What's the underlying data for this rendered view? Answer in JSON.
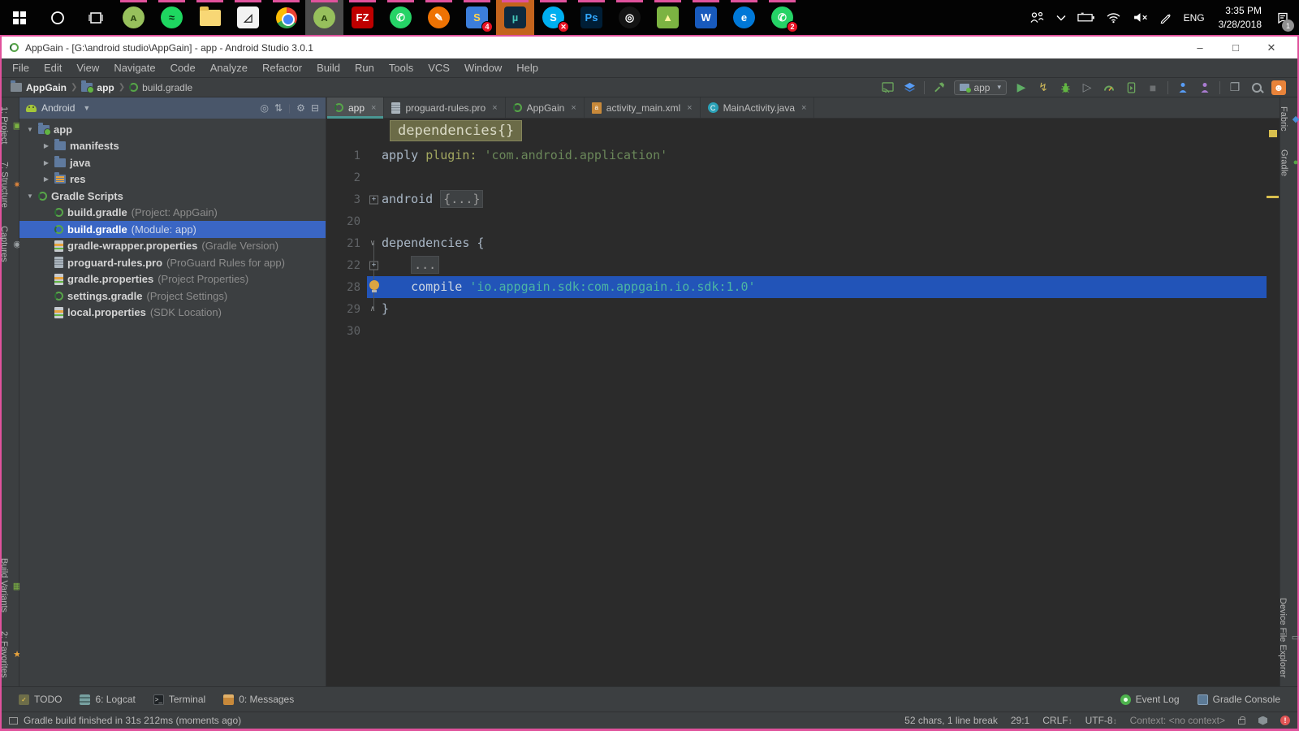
{
  "colors": {
    "accent_pink": "#e0529c",
    "panel_bg": "#3c3f41",
    "panel_header_bg": "#49566a",
    "editor_bg": "#2b2b2b",
    "tree_selection": "#3a66c4",
    "editor_selection": "#2254b8",
    "tab_underline": "#4a9793",
    "string_green": "#6a8759",
    "string_teal": "#4cb5a3",
    "lens_bg": "#6b6b47",
    "line_number": "#606366",
    "bulb_yellow": "#dca541",
    "warning_stripe": "#d9bf4e",
    "error_red": "#e05555",
    "event_green": "#4db24d"
  },
  "taskbar": {
    "apps": [
      {
        "name": "start-button",
        "kind": "win",
        "open": false
      },
      {
        "name": "cortana-button",
        "kind": "ring",
        "open": false
      },
      {
        "name": "task-view-button",
        "kind": "taskview",
        "open": false
      },
      {
        "name": "android-studio-icon",
        "kind": "tile",
        "shape": "circle",
        "bg": "#97c05c",
        "fg": "#2d4a12",
        "glyph": "ᴀ",
        "open": true
      },
      {
        "name": "spotify-icon",
        "kind": "tile",
        "shape": "circle",
        "bg": "#1ed760",
        "fg": "#0a2a12",
        "glyph": "≈",
        "open": true
      },
      {
        "name": "file-explorer-icon",
        "kind": "folder",
        "open": true
      },
      {
        "name": "notepad-icon",
        "kind": "tile",
        "shape": "square",
        "bg": "#f2f2f2",
        "fg": "#222222",
        "glyph": "◿",
        "open": true
      },
      {
        "name": "chrome-icon",
        "kind": "chrome",
        "open": true
      },
      {
        "name": "android-studio-active-icon",
        "kind": "tile",
        "shape": "circle",
        "bg": "#97c05c",
        "fg": "#2d4a12",
        "glyph": "ᴀ",
        "open": true,
        "active": true
      },
      {
        "name": "filezilla-icon",
        "kind": "tile",
        "shape": "square",
        "bg": "#bf0000",
        "fg": "#ffffff",
        "glyph": "FZ",
        "open": true
      },
      {
        "name": "whatsapp-icon",
        "kind": "tile",
        "shape": "circle",
        "bg": "#25d366",
        "fg": "#ffffff",
        "glyph": "✆",
        "open": true
      },
      {
        "name": "pen-tool-app-icon",
        "kind": "tile",
        "shape": "circle",
        "bg": "#ee7203",
        "fg": "#ffffff",
        "glyph": "✎",
        "open": true
      },
      {
        "name": "mail-app-badge-icon",
        "kind": "tile",
        "shape": "square",
        "bg": "#3c7edb",
        "fg": "#ffd34d",
        "glyph": "S",
        "badge": "4",
        "open": true
      },
      {
        "name": "utorrent-flashing-icon",
        "kind": "tile",
        "shape": "square",
        "bg": "#0e2a3f",
        "fg": "#45c8bc",
        "glyph": "µ",
        "open": true,
        "flash": true
      },
      {
        "name": "skype-error-icon",
        "kind": "tile",
        "shape": "circle",
        "bg": "#00aff0",
        "fg": "#ffffff",
        "glyph": "S",
        "badge": "✕",
        "open": true
      },
      {
        "name": "photoshop-icon",
        "kind": "tile",
        "shape": "square",
        "bg": "#001e36",
        "fg": "#31a8ff",
        "glyph": "Ps",
        "open": true
      },
      {
        "name": "recorder-app-icon",
        "kind": "tile",
        "shape": "circle",
        "bg": "#141414",
        "fg": "#ffffff",
        "glyph": "◎",
        "open": true
      },
      {
        "name": "photos-app-icon",
        "kind": "tile",
        "shape": "square",
        "bg": "#7cb342",
        "fg": "#fff59d",
        "glyph": "▲",
        "open": true
      },
      {
        "name": "word-icon",
        "kind": "tile",
        "shape": "square",
        "bg": "#185abd",
        "fg": "#ffffff",
        "glyph": "W",
        "open": true
      },
      {
        "name": "edge-icon",
        "kind": "tile",
        "shape": "circle",
        "bg": "#0078d7",
        "fg": "#ffffff",
        "glyph": "e",
        "open": true
      },
      {
        "name": "whatsapp-badge-icon",
        "kind": "tile",
        "shape": "circle",
        "bg": "#25d366",
        "fg": "#ffffff",
        "glyph": "✆",
        "badge": "2",
        "open": true
      }
    ],
    "tray": [
      {
        "name": "people-icon",
        "svg": "people"
      },
      {
        "name": "chevron-icon",
        "svg": "chevron"
      },
      {
        "name": "battery-icon",
        "svg": "battery"
      },
      {
        "name": "wifi-icon",
        "svg": "wifi"
      },
      {
        "name": "volume-muted-icon",
        "svg": "mute"
      },
      {
        "name": "pen-icon",
        "svg": "pen"
      }
    ],
    "language": "ENG",
    "time": "3:35 PM",
    "date": "3/28/2018",
    "notification_badge": "1"
  },
  "window": {
    "title": "AppGain - [G:\\android studio\\AppGain] - app - Android Studio 3.0.1"
  },
  "menu": [
    "File",
    "Edit",
    "View",
    "Navigate",
    "Code",
    "Analyze",
    "Refactor",
    "Build",
    "Run",
    "Tools",
    "VCS",
    "Window",
    "Help"
  ],
  "breadcrumb": [
    {
      "label": "AppGain",
      "icon": "folder-dark",
      "bold": true
    },
    {
      "label": "app",
      "icon": "folder-app",
      "bold": true
    },
    {
      "label": "build.gradle",
      "icon": "gradle",
      "bold": false
    }
  ],
  "run_toolbar": {
    "config_label": "app"
  },
  "left_stripe": {
    "top": [
      {
        "label": "1: Project",
        "icon": "▣",
        "icolor": "#7cb342"
      },
      {
        "label": "7: Structure",
        "icon": "✷",
        "icolor": "#d9833c"
      },
      {
        "label": "Captures",
        "icon": "◉",
        "icolor": "#9aa0a3"
      }
    ],
    "bottom": [
      {
        "label": "Build Variants",
        "icon": "▦",
        "icolor": "#7cb342"
      },
      {
        "label": "2: Favorites",
        "icon": "★",
        "icolor": "#e8a33d"
      }
    ]
  },
  "right_stripe": {
    "top": [
      {
        "label": "Fabric",
        "icon": "◆",
        "icolor": "#4a90d9"
      },
      {
        "label": "Gradle",
        "icon": "●",
        "icolor": "#57a549"
      }
    ],
    "bottom": [
      {
        "label": "Device File Explorer",
        "icon": "▭",
        "icolor": "#9aa0a3"
      }
    ]
  },
  "project_panel": {
    "view_label": "Android",
    "header_tools": [
      {
        "name": "locate-file-icon",
        "glyph": "◎"
      },
      {
        "name": "collapse-all-icon",
        "glyph": "⇅"
      },
      {
        "name": "toolbar-divider",
        "glyph": "|"
      },
      {
        "name": "settings-gear-icon",
        "glyph": "⚙"
      },
      {
        "name": "hide-panel-icon",
        "glyph": "⊟"
      }
    ],
    "tree": [
      {
        "label": "app",
        "icon": "folder-app",
        "indent": 0,
        "chev": "▼",
        "bold": true
      },
      {
        "label": "manifests",
        "icon": "folder",
        "indent": 1,
        "chev": "▶"
      },
      {
        "label": "java",
        "icon": "folder",
        "indent": 1,
        "chev": "▶"
      },
      {
        "label": "res",
        "icon": "folder-res",
        "indent": 1,
        "chev": "▶"
      },
      {
        "label": "Gradle Scripts",
        "icon": "gradle",
        "indent": 0,
        "chev": "▼"
      },
      {
        "label": "build.gradle",
        "detail": "(Project: AppGain)",
        "icon": "gradle",
        "indent": 1
      },
      {
        "label": "build.gradle",
        "detail": "(Module: app)",
        "icon": "gradle",
        "indent": 1,
        "selected": true
      },
      {
        "label": "gradle-wrapper.properties",
        "detail": "(Gradle Version)",
        "icon": "props",
        "indent": 1
      },
      {
        "label": "proguard-rules.pro",
        "detail": "(ProGuard Rules for app)",
        "icon": "file",
        "indent": 1
      },
      {
        "label": "gradle.properties",
        "detail": "(Project Properties)",
        "icon": "props",
        "indent": 1
      },
      {
        "label": "settings.gradle",
        "detail": "(Project Settings)",
        "icon": "gradle",
        "indent": 1
      },
      {
        "label": "local.properties",
        "detail": "(SDK Location)",
        "icon": "props",
        "indent": 1
      }
    ]
  },
  "editor": {
    "tabs": [
      {
        "label": "app",
        "icon": "gradle",
        "active": true
      },
      {
        "label": "proguard-rules.pro",
        "icon": "file",
        "active": false
      },
      {
        "label": "AppGain",
        "icon": "gradle",
        "active": false
      },
      {
        "label": "activity_main.xml",
        "icon": "xml",
        "active": false
      },
      {
        "label": "MainActivity.java",
        "icon": "class",
        "active": false
      }
    ],
    "lens_text": "dependencies{}",
    "lines": [
      {
        "num": "1",
        "tokens": [
          {
            "t": "apply ",
            "c": "plain"
          },
          {
            "t": "plugin: ",
            "c": "param"
          },
          {
            "t": "'com.android.application'",
            "c": "string"
          }
        ]
      },
      {
        "num": "2",
        "tokens": []
      },
      {
        "num": "3",
        "fold": "plus",
        "tokens": [
          {
            "t": "android ",
            "c": "plain"
          },
          {
            "t": "{...}",
            "c": "foldbox"
          }
        ]
      },
      {
        "num": "20",
        "tokens": []
      },
      {
        "num": "21",
        "fold": "open",
        "tokens": [
          {
            "t": "dependencies {",
            "c": "plain"
          }
        ]
      },
      {
        "num": "22",
        "fold": "plus",
        "tokens": [
          {
            "t": "    ",
            "c": "plain"
          },
          {
            "t": "...",
            "c": "foldbox"
          }
        ]
      },
      {
        "num": "28",
        "selected": true,
        "bulb": true,
        "tokens": [
          {
            "t": "    compile ",
            "c": "plain"
          },
          {
            "t": "'io.appgain.sdk:com.appgain.io.sdk:1.0'",
            "c": "string_sel"
          }
        ]
      },
      {
        "num": "29",
        "fold": "close",
        "tokens": [
          {
            "t": "}",
            "c": "plain"
          }
        ]
      },
      {
        "num": "30",
        "tokens": []
      }
    ]
  },
  "bottom_bar": {
    "left": [
      {
        "label": "TODO",
        "icon": "todo"
      },
      {
        "label": "6: Logcat",
        "icon": "logcat"
      },
      {
        "label": "Terminal",
        "icon": "terminal"
      },
      {
        "label": "0: Messages",
        "icon": "messages"
      }
    ],
    "right": [
      {
        "label": "Event Log",
        "icon": "event"
      },
      {
        "label": "Gradle Console",
        "icon": "console"
      }
    ]
  },
  "status_bar": {
    "message": "Gradle build finished in 31s 212ms (moments ago)",
    "selection_info": "52 chars, 1 line break",
    "caret": "29:1",
    "line_ending": "CRLF",
    "encoding": "UTF-8",
    "context": "Context: <no context>"
  }
}
